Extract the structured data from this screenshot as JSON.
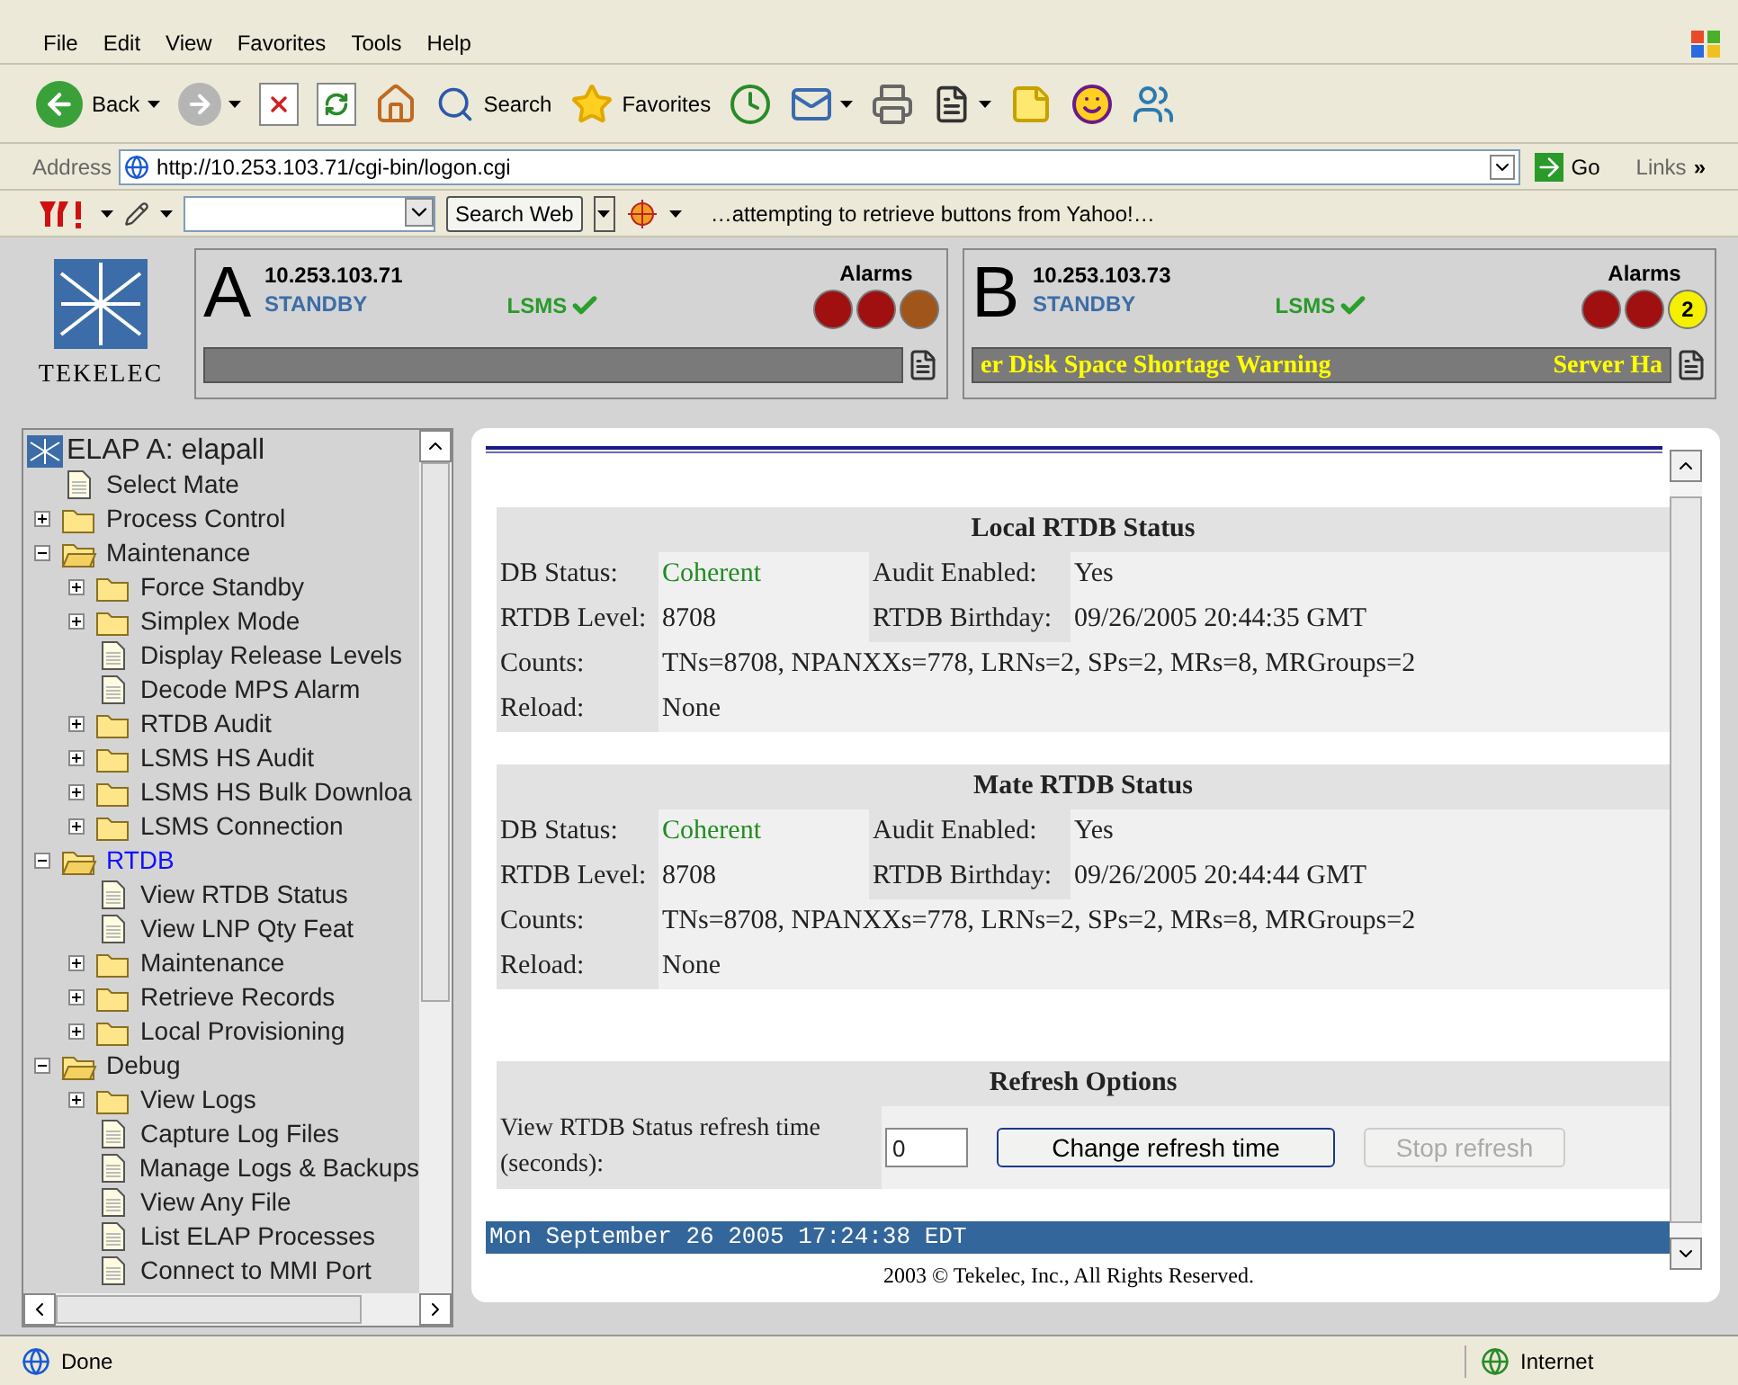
{
  "menu": [
    "File",
    "Edit",
    "View",
    "Favorites",
    "Tools",
    "Help"
  ],
  "toolbar": [
    {
      "kind": "back",
      "label": "Back"
    },
    {
      "kind": "forward"
    },
    {
      "kind": "stop"
    },
    {
      "kind": "refresh"
    },
    {
      "kind": "home"
    },
    {
      "kind": "search",
      "label": "Search"
    },
    {
      "kind": "favorites",
      "label": "Favorites"
    },
    {
      "kind": "history"
    },
    {
      "kind": "mail"
    },
    {
      "kind": "print"
    },
    {
      "kind": "word"
    },
    {
      "kind": "note"
    },
    {
      "kind": "messenger"
    },
    {
      "kind": "people"
    }
  ],
  "address": {
    "label": "Address",
    "url": "http://10.253.103.71/cgi-bin/logon.cgi",
    "go": "Go",
    "links": "Links",
    "more": "»"
  },
  "yahoo_bar": {
    "search_button": "Search Web",
    "message": "…attempting to retrieve buttons from Yahoo!…"
  },
  "header": {
    "logo_text": "TEKELEC",
    "servers": [
      {
        "letter": "A",
        "ip": "10.253.103.71",
        "role": "STANDBY",
        "lsms": "LSMS",
        "alarms_label": "Alarms",
        "alarms": [
          {
            "color": "#a01010"
          },
          {
            "color": "#a01010"
          },
          {
            "color": "#a0561a"
          }
        ]
      },
      {
        "letter": "B",
        "ip": "10.253.103.73",
        "role": "STANDBY",
        "lsms": "LSMS",
        "alarms_label": "Alarms",
        "alarms": [
          {
            "color": "#a01010"
          },
          {
            "color": "#a01010"
          },
          {
            "color": "#f5f000",
            "count": "2"
          }
        ],
        "ticker": [
          "er Disk Space Shortage Warning",
          "Server Ha"
        ]
      }
    ]
  },
  "tree": {
    "root": "ELAP A: elapall",
    "items": [
      {
        "kind": "page",
        "label": "Select Mate",
        "selected": false
      },
      {
        "kind": "folder",
        "label": "Process Control",
        "expanded": false,
        "selected": false
      },
      {
        "kind": "folder",
        "label": "Maintenance",
        "expanded": true,
        "selected": false,
        "children": [
          {
            "kind": "folder",
            "label": "Force Standby",
            "expanded": false,
            "selected": false
          },
          {
            "kind": "folder",
            "label": "Simplex Mode",
            "expanded": false,
            "selected": false
          },
          {
            "kind": "page",
            "label": "Display Release Levels",
            "selected": false
          },
          {
            "kind": "page",
            "label": "Decode MPS Alarm",
            "selected": false
          },
          {
            "kind": "folder",
            "label": "RTDB Audit",
            "expanded": false,
            "selected": false
          },
          {
            "kind": "folder",
            "label": "LSMS HS Audit",
            "expanded": false,
            "selected": false
          },
          {
            "kind": "folder",
            "label": "LSMS HS Bulk Downloa",
            "expanded": false,
            "selected": false
          },
          {
            "kind": "folder",
            "label": "LSMS Connection",
            "expanded": false,
            "selected": false
          }
        ]
      },
      {
        "kind": "folder",
        "label": "RTDB",
        "expanded": true,
        "selected": true,
        "children": [
          {
            "kind": "page",
            "label": "View RTDB Status",
            "selected": false
          },
          {
            "kind": "page",
            "label": "View LNP Qty Feat",
            "selected": false
          },
          {
            "kind": "folder",
            "label": "Maintenance",
            "expanded": false,
            "selected": false
          },
          {
            "kind": "folder",
            "label": "Retrieve Records",
            "expanded": false,
            "selected": false
          },
          {
            "kind": "folder",
            "label": "Local Provisioning",
            "expanded": false,
            "selected": false
          }
        ]
      },
      {
        "kind": "folder",
        "label": "Debug",
        "expanded": true,
        "selected": false,
        "children": [
          {
            "kind": "folder",
            "label": "View Logs",
            "expanded": false,
            "selected": false
          },
          {
            "kind": "page",
            "label": "Capture Log Files",
            "selected": false
          },
          {
            "kind": "page",
            "label": "Manage Logs & Backups",
            "selected": false
          },
          {
            "kind": "page",
            "label": "View Any File",
            "selected": false
          },
          {
            "kind": "page",
            "label": "List ELAP Processes",
            "selected": false
          },
          {
            "kind": "page",
            "label": "Connect to MMI Port",
            "selected": false
          }
        ]
      }
    ]
  },
  "sections": [
    {
      "title": "Local RTDB Status",
      "rows": [
        {
          "label": "DB Status:",
          "value": "Coherent",
          "color": "#228b22",
          "label2": "Audit Enabled:",
          "value2": "Yes"
        },
        {
          "label": "RTDB Level:",
          "value": "8708",
          "label2": "RTDB Birthday:",
          "value2": "09/26/2005 20:44:35 GMT"
        },
        {
          "label": "Counts:",
          "value": "TNs=8708, NPANXXs=778, LRNs=2, SPs=2, MRs=8, MRGroups=2"
        },
        {
          "label": "Reload:",
          "value": "None"
        }
      ]
    },
    {
      "title": "Mate RTDB Status",
      "rows": [
        {
          "label": "DB Status:",
          "value": "Coherent",
          "color": "#228b22",
          "label2": "Audit Enabled:",
          "value2": "Yes"
        },
        {
          "label": "RTDB Level:",
          "value": "8708",
          "label2": "RTDB Birthday:",
          "value2": "09/26/2005 20:44:44 GMT"
        },
        {
          "label": "Counts:",
          "value": "TNs=8708, NPANXXs=778, LRNs=2, SPs=2, MRs=8, MRGroups=2"
        },
        {
          "label": "Reload:",
          "value": "None"
        }
      ]
    }
  ],
  "refresh": {
    "title": "Refresh Options",
    "label": "View RTDB Status refresh time (seconds):",
    "value": "0",
    "buttons": [
      {
        "label": "Change refresh time",
        "disabled": false
      },
      {
        "label": "Stop refresh",
        "disabled": true
      }
    ]
  },
  "timestamp": "Mon September 26 2005 17:24:38 EDT",
  "copyright": "2003 © Tekelec, Inc., All Rights Reserved.",
  "status_bar": {
    "text": "Done",
    "zone": "Internet"
  }
}
